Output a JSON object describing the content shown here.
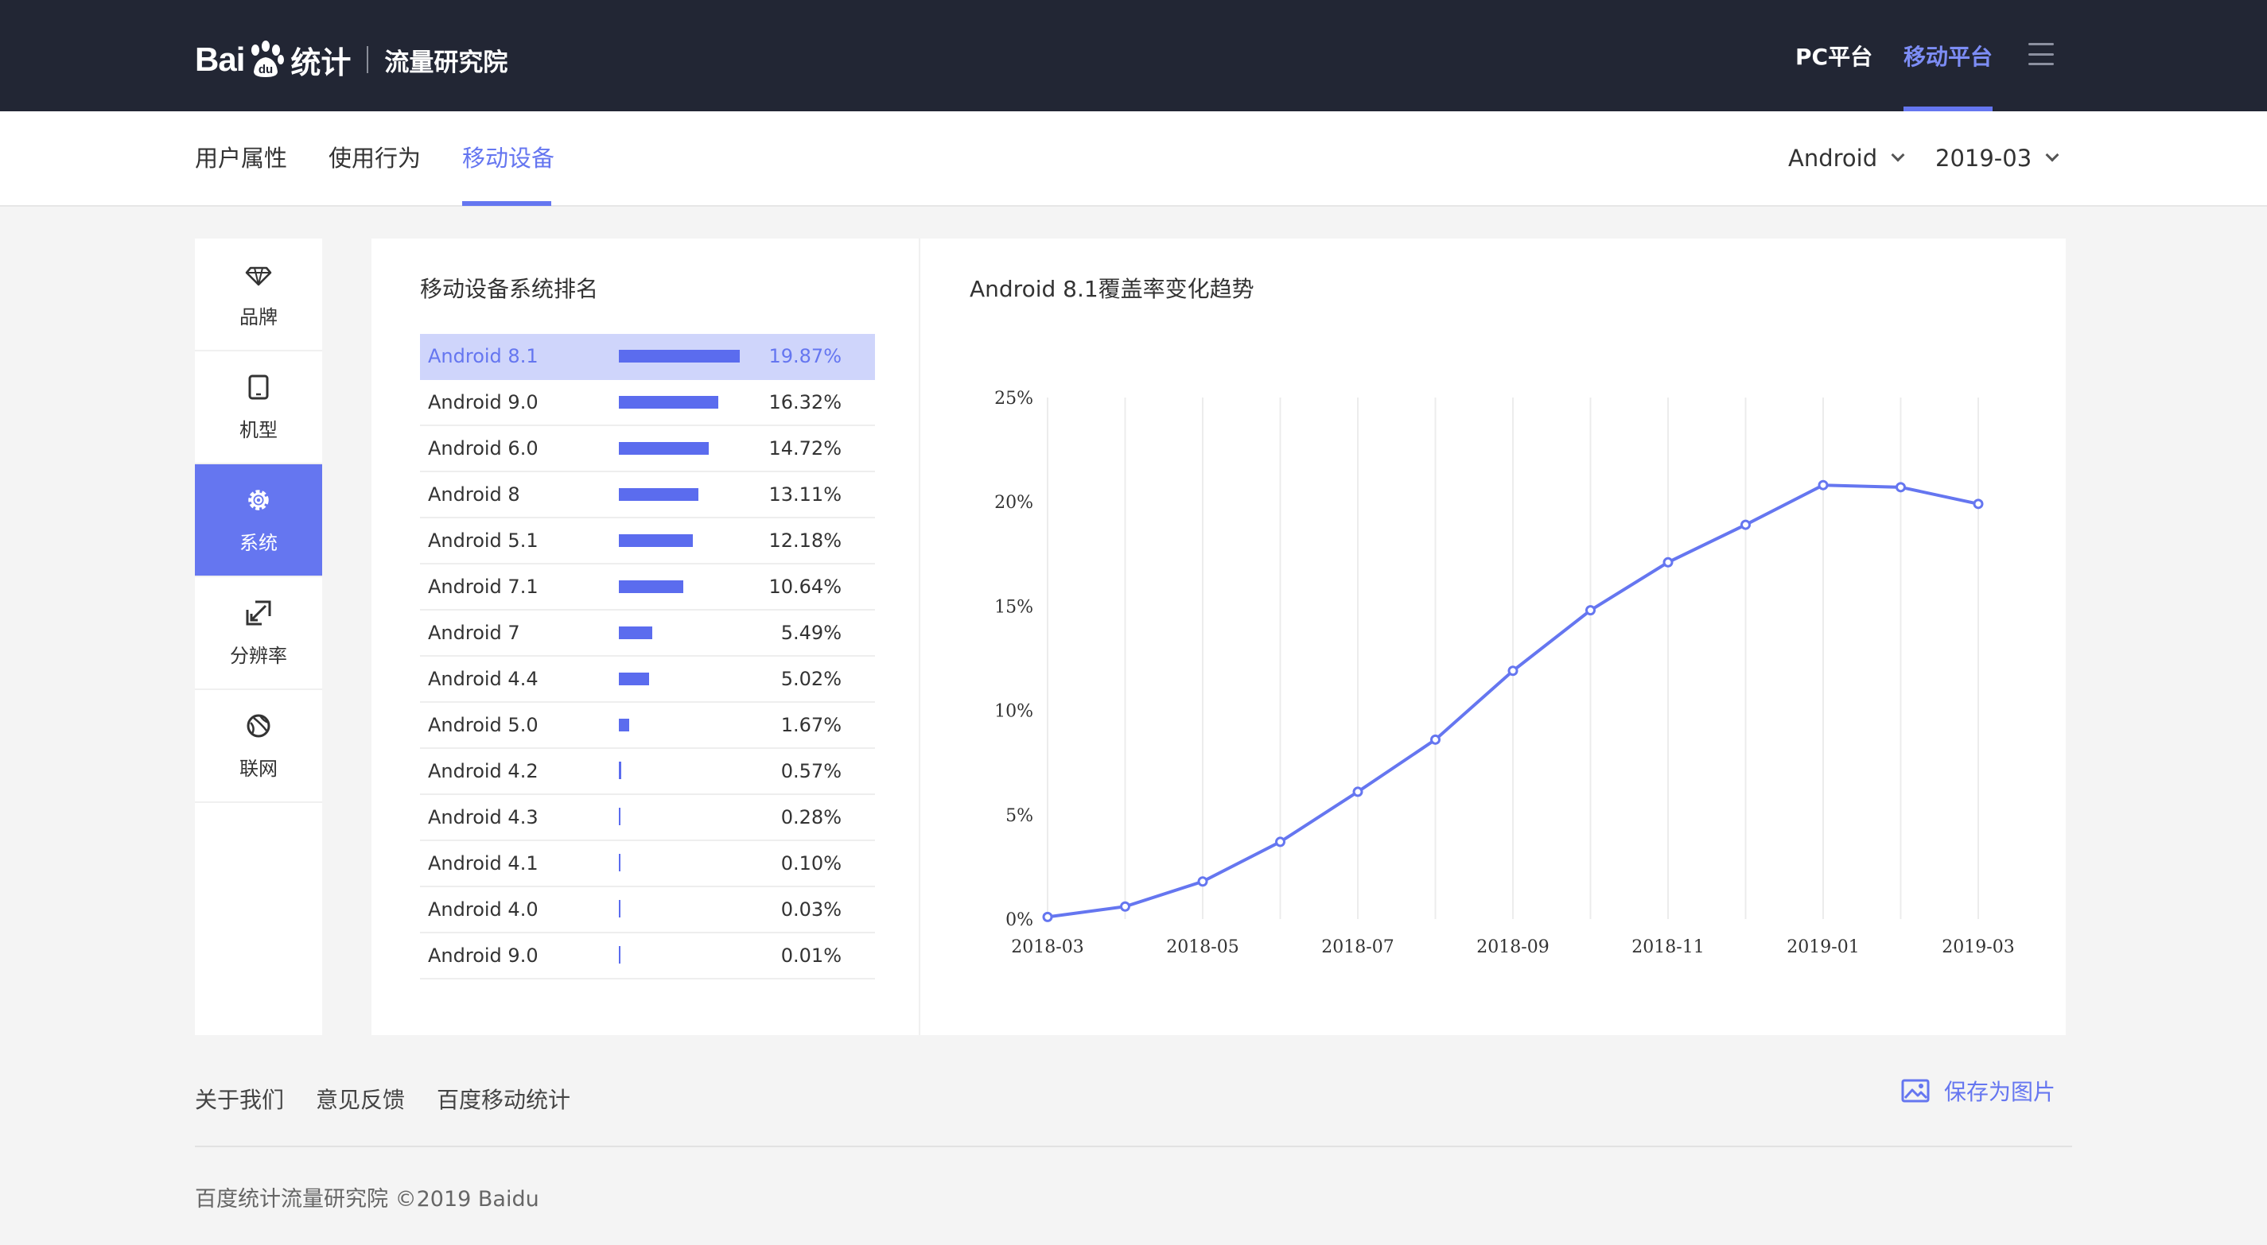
{
  "header": {
    "logo_text_left": "Bai",
    "logo_text_right": "统计",
    "logo_sub": "流量研究院",
    "nav_pc": "PC平台",
    "nav_mobile": "移动平台"
  },
  "subnav": {
    "tabs": [
      {
        "label": "用户属性"
      },
      {
        "label": "使用行为"
      },
      {
        "label": "移动设备"
      }
    ],
    "platform_select": "Android",
    "date_select": "2019-03"
  },
  "sidebar": {
    "items": [
      {
        "label": "品牌",
        "icon": "diamond-icon"
      },
      {
        "label": "机型",
        "icon": "tablet-icon"
      },
      {
        "label": "系统",
        "icon": "gear-icon"
      },
      {
        "label": "分辨率",
        "icon": "resize-icon"
      },
      {
        "label": "联网",
        "icon": "network-icon"
      }
    ]
  },
  "ranking": {
    "title": "移动设备系统排名",
    "rows": [
      {
        "name": "Android 8.1",
        "value": "19.87%"
      },
      {
        "name": "Android 9.0",
        "value": "16.32%"
      },
      {
        "name": "Android 6.0",
        "value": "14.72%"
      },
      {
        "name": "Android 8",
        "value": "13.11%"
      },
      {
        "name": "Android 5.1",
        "value": "12.18%"
      },
      {
        "name": "Android 7.1",
        "value": "10.64%"
      },
      {
        "name": "Android 7",
        "value": "5.49%"
      },
      {
        "name": "Android 4.4",
        "value": "5.02%"
      },
      {
        "name": "Android 5.0",
        "value": "1.67%"
      },
      {
        "name": "Android 4.2",
        "value": "0.57%"
      },
      {
        "name": "Android 4.3",
        "value": "0.28%"
      },
      {
        "name": "Android 4.1",
        "value": "0.10%"
      },
      {
        "name": "Android 4.0",
        "value": "0.03%"
      },
      {
        "name": "Android 9.0",
        "value": "0.01%"
      }
    ]
  },
  "chart_data": {
    "type": "line",
    "title": "Android 8.1覆盖率变化趋势",
    "x": [
      "2018-03",
      "2018-04",
      "2018-05",
      "2018-06",
      "2018-07",
      "2018-08",
      "2018-09",
      "2018-10",
      "2018-11",
      "2018-12",
      "2019-01",
      "2019-02",
      "2019-03"
    ],
    "x_tick_labels": [
      "2018-03",
      "2018-05",
      "2018-07",
      "2018-09",
      "2018-11",
      "2019-01",
      "2019-03"
    ],
    "y_tick_labels": [
      "0%",
      "5%",
      "10%",
      "15%",
      "20%",
      "25%"
    ],
    "series": [
      {
        "values": [
          0.1,
          0.6,
          1.8,
          3.7,
          6.1,
          8.6,
          11.9,
          14.8,
          17.1,
          18.9,
          20.8,
          20.7,
          19.9
        ]
      }
    ],
    "ylim": [
      0,
      25
    ],
    "y_unit": "%",
    "grid": "vertical",
    "color": "#6576f0"
  },
  "footer": {
    "links": [
      "关于我们",
      "意见反馈",
      "百度移动统计"
    ],
    "save_label": "保存为图片",
    "copyright": "百度统计流量研究院 ©2019 Baidu"
  }
}
